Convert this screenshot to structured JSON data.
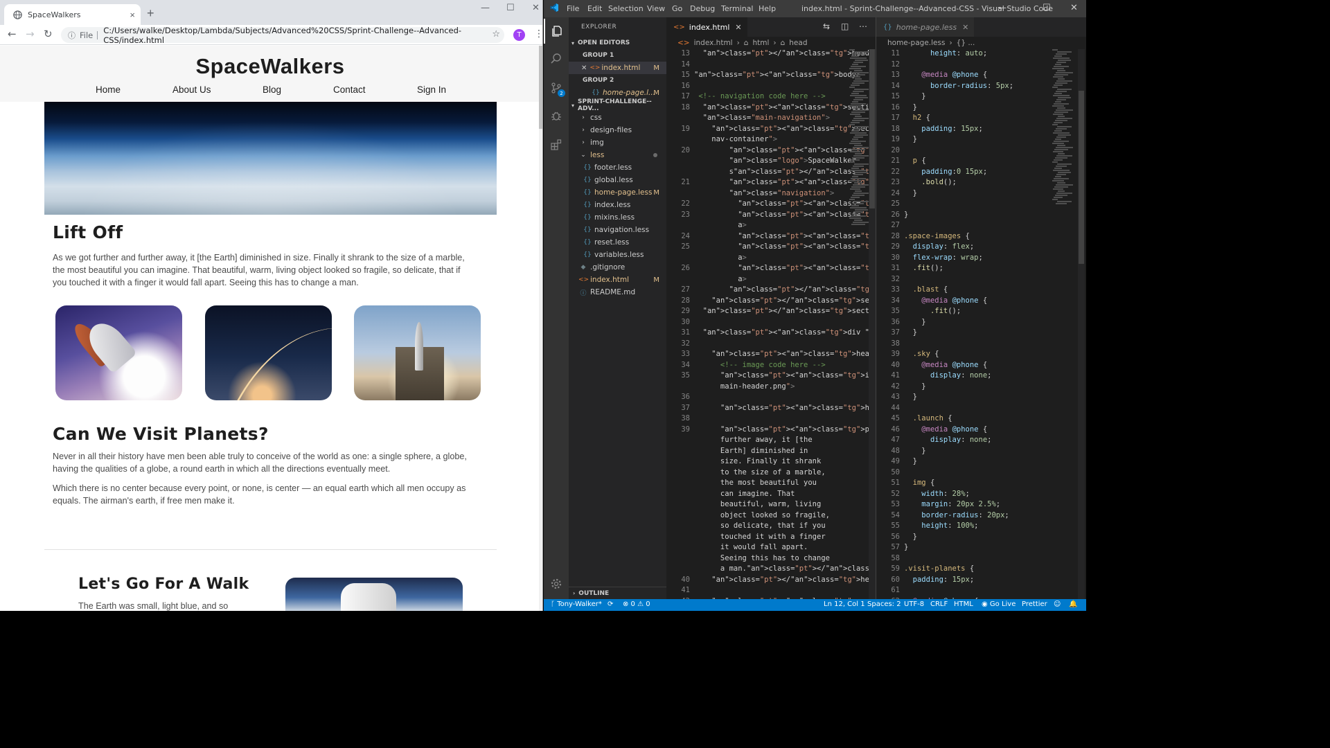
{
  "browser": {
    "tab_title": "SpaceWalkers",
    "new_tab": "+",
    "close_tab": "×",
    "win_min": "—",
    "win_max": "☐",
    "win_close": "✕",
    "info_icon": "ⓘ",
    "file_label": "File",
    "url": "C:/Users/walke/Desktop/Lambda/Subjects/Advanced%20CSS/Sprint-Challenge--Advanced-CSS/index.html",
    "avatar_letter": "T",
    "star": "☆",
    "menu": "⋮"
  },
  "site": {
    "logo": "SpaceWalkers",
    "nav": [
      "Home",
      "About Us",
      "Blog",
      "Contact",
      "Sign In"
    ],
    "section1_title": "Lift Off",
    "section1_text": "As we got further and further away, it [the Earth] diminished in size. Finally it shrank to the size of a marble, the most beautiful you can imagine. That beautiful, warm, living object looked so fragile, so delicate, that if you touched it with a finger it would fall apart. Seeing this has to change a man.",
    "section2_title": "Can We Visit Planets?",
    "section2_p1": "Never in all their history have men been able truly to conceive of the world as one: a single sphere, a globe, having the qualities of a globe, a round earth in which all the directions eventually meet.",
    "section2_p2": "Which there is no center because every point, or none, is center — an equal earth which all men occupy as equals. The airman's earth, if free men make it.",
    "section3_title": "Let's Go For A Walk",
    "section3_text": "The Earth was small, light blue, and so"
  },
  "vscode": {
    "menu": [
      "File",
      "Edit",
      "Selection",
      "View",
      "Go",
      "Debug",
      "Terminal",
      "Help"
    ],
    "title": "index.html - Sprint-Challenge--Advanced-CSS - Visual Studio Code",
    "explorer_title": "EXPLORER",
    "open_editors": "OPEN EDITORS",
    "group1": "GROUP 1",
    "group2": "GROUP 2",
    "open1": "index.html",
    "open2": "home-page.l...",
    "project": "SPRINT-CHALLENGE--ADV...",
    "modified_mark": "M",
    "scm_badge": "2",
    "folders": [
      "css",
      "design-files",
      "img",
      "less"
    ],
    "less_files": [
      "footer.less",
      "global.less",
      "home-page.less",
      "index.less",
      "mixins.less",
      "navigation.less",
      "reset.less",
      "variables.less"
    ],
    "root_files": [
      ".gitignore",
      "index.html",
      "README.md"
    ],
    "outline": "OUTLINE",
    "ed1_tab": "index.html",
    "ed1_crumbs": [
      "index.html",
      "html",
      "head"
    ],
    "ed2_tab": "home-page.less",
    "ed2_crumbs": [
      "home-page.less",
      "{} ..."
    ],
    "ed1_lines": [
      {
        "n": "13",
        "t": "  </head>"
      },
      {
        "n": "14",
        "t": ""
      },
      {
        "n": "15",
        "t": "<body>"
      },
      {
        "n": "16",
        "t": ""
      },
      {
        "n": "17",
        "t": " <!-- navigation code here -->"
      },
      {
        "n": "18",
        "t": "  <section"
      },
      {
        "n": "",
        "t": "  class=\"main-navigation\">"
      },
      {
        "n": "19",
        "t": "    <section class=\"container"
      },
      {
        "n": "",
        "t": "    nav-container\">"
      },
      {
        "n": "20",
        "t": "        <h1"
      },
      {
        "n": "",
        "t": "        class=\"logo\">SpaceWalker"
      },
      {
        "n": "",
        "t": "        s</h1>"
      },
      {
        "n": "21",
        "t": "        <section"
      },
      {
        "n": "",
        "t": "        class=\"navigation\">"
      },
      {
        "n": "22",
        "t": "          <a href=\"#\">Home</a>"
      },
      {
        "n": "23",
        "t": "          <a href=\"#\">About Us</"
      },
      {
        "n": "",
        "t": "          a>"
      },
      {
        "n": "24",
        "t": "          <a href=\"#\">Blog</a>"
      },
      {
        "n": "25",
        "t": "          <a href=\"#\">Contact</"
      },
      {
        "n": "",
        "t": "          a>"
      },
      {
        "n": "26",
        "t": "          <a href=\"#\">Sign In</"
      },
      {
        "n": "",
        "t": "          a>"
      },
      {
        "n": "27",
        "t": "        </section>"
      },
      {
        "n": "28",
        "t": "    </section>"
      },
      {
        "n": "29",
        "t": "  </section>"
      },
      {
        "n": "30",
        "t": ""
      },
      {
        "n": "31",
        "t": "  <div class=\"container home\">"
      },
      {
        "n": "32",
        "t": ""
      },
      {
        "n": "33",
        "t": "    <header class=\"intro\">"
      },
      {
        "n": "34",
        "t": "      <!-- image code here -->"
      },
      {
        "n": "35",
        "t": "      <img src=\"img/"
      },
      {
        "n": "",
        "t": "      main-header.png\">"
      },
      {
        "n": "36",
        "t": ""
      },
      {
        "n": "37",
        "t": "      <h2>Lift Off</h2>"
      },
      {
        "n": "38",
        "t": ""
      },
      {
        "n": "39",
        "t": "      <p>As we got further and"
      },
      {
        "n": "",
        "t": "      further away, it [the"
      },
      {
        "n": "",
        "t": "      Earth] diminished in"
      },
      {
        "n": "",
        "t": "      size. Finally it shrank"
      },
      {
        "n": "",
        "t": "      to the size of a marble,"
      },
      {
        "n": "",
        "t": "      the most beautiful you"
      },
      {
        "n": "",
        "t": "      can imagine. That"
      },
      {
        "n": "",
        "t": "      beautiful, warm, living"
      },
      {
        "n": "",
        "t": "      object looked so fragile,"
      },
      {
        "n": "",
        "t": "      so delicate, that if you"
      },
      {
        "n": "",
        "t": "      touched it with a finger"
      },
      {
        "n": "",
        "t": "      it would fall apart."
      },
      {
        "n": "",
        "t": "      Seeing this has to change"
      },
      {
        "n": "",
        "t": "      a man.</p>"
      },
      {
        "n": "40",
        "t": "    </header>"
      },
      {
        "n": "41",
        "t": ""
      },
      {
        "n": "42",
        "t": "    <section"
      }
    ],
    "ed2_lines": [
      {
        "n": "11",
        "t": "      height: auto;"
      },
      {
        "n": "12",
        "t": ""
      },
      {
        "n": "13",
        "t": "    @media @phone {"
      },
      {
        "n": "14",
        "t": "      border-radius: 5px;"
      },
      {
        "n": "15",
        "t": "    }"
      },
      {
        "n": "16",
        "t": "  }"
      },
      {
        "n": "17",
        "t": "  h2 {"
      },
      {
        "n": "18",
        "t": "    padding: 15px;"
      },
      {
        "n": "19",
        "t": "  }"
      },
      {
        "n": "20",
        "t": ""
      },
      {
        "n": "21",
        "t": "  p {"
      },
      {
        "n": "22",
        "t": "    padding:0 15px;"
      },
      {
        "n": "23",
        "t": "    .bold();"
      },
      {
        "n": "24",
        "t": "  }"
      },
      {
        "n": "25",
        "t": ""
      },
      {
        "n": "26",
        "t": "}"
      },
      {
        "n": "27",
        "t": ""
      },
      {
        "n": "28",
        "t": ".space-images {"
      },
      {
        "n": "29",
        "t": "  display: flex;"
      },
      {
        "n": "30",
        "t": "  flex-wrap: wrap;"
      },
      {
        "n": "31",
        "t": "  .fit();"
      },
      {
        "n": "32",
        "t": ""
      },
      {
        "n": "33",
        "t": "  .blast {"
      },
      {
        "n": "34",
        "t": "    @media @phone {"
      },
      {
        "n": "35",
        "t": "      .fit();"
      },
      {
        "n": "36",
        "t": "    }"
      },
      {
        "n": "37",
        "t": "  }"
      },
      {
        "n": "38",
        "t": ""
      },
      {
        "n": "39",
        "t": "  .sky {"
      },
      {
        "n": "40",
        "t": "    @media @phone {"
      },
      {
        "n": "41",
        "t": "      display: none;"
      },
      {
        "n": "42",
        "t": "    }"
      },
      {
        "n": "43",
        "t": "  }"
      },
      {
        "n": "44",
        "t": ""
      },
      {
        "n": "45",
        "t": "  .launch {"
      },
      {
        "n": "46",
        "t": "    @media @phone {"
      },
      {
        "n": "47",
        "t": "      display: none;"
      },
      {
        "n": "48",
        "t": "    }"
      },
      {
        "n": "49",
        "t": "  }"
      },
      {
        "n": "50",
        "t": ""
      },
      {
        "n": "51",
        "t": "  img {"
      },
      {
        "n": "52",
        "t": "    width: 28%;"
      },
      {
        "n": "53",
        "t": "    margin: 20px 2.5%;"
      },
      {
        "n": "54",
        "t": "    border-radius: 20px;"
      },
      {
        "n": "55",
        "t": "    height: 100%;"
      },
      {
        "n": "56",
        "t": "  }"
      },
      {
        "n": "57",
        "t": "}"
      },
      {
        "n": "58",
        "t": ""
      },
      {
        "n": "59",
        "t": ".visit-planets {"
      },
      {
        "n": "60",
        "t": "  padding: 15px;"
      },
      {
        "n": "61",
        "t": ""
      },
      {
        "n": "62",
        "t": "  @media @phone {"
      }
    ],
    "status": {
      "branch": "Tony-Walker*",
      "sync": "⟳",
      "errors": "⊗ 0 ⚠ 0",
      "position": "Ln 12, Col 1",
      "spaces": "Spaces: 2",
      "encoding": "UTF-8",
      "eol": "CRLF",
      "language": "HTML",
      "golive": "Go Live",
      "prettier": "Prettier"
    }
  },
  "colors": {
    "vscode_blue": "#007acc",
    "chrome_tabstrip": "#dee1e6",
    "avatar": "#a142f4"
  }
}
